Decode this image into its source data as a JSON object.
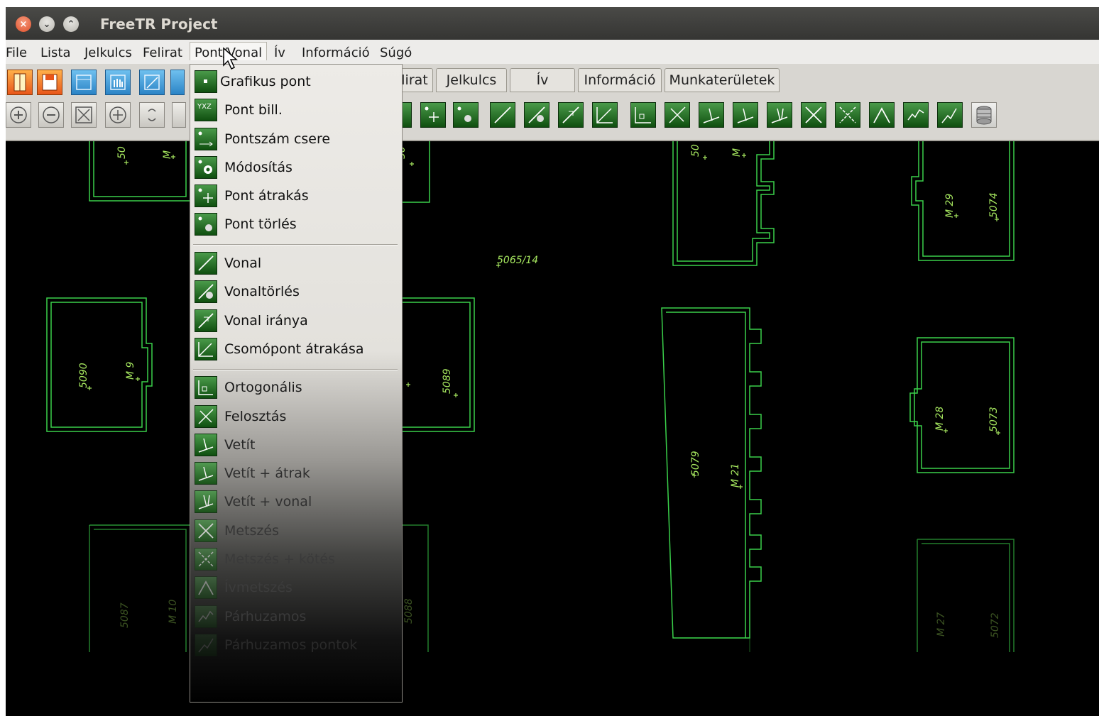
{
  "window": {
    "title": "FreeTR Project",
    "controls": {
      "close": "×",
      "minimize": "⌄",
      "maximize": "⌃"
    }
  },
  "menubar": {
    "items": [
      "File",
      "Lista",
      "Jelkulcs",
      "Felirat",
      "Pont/Vonal",
      "Ív",
      "Információ",
      "Súgó"
    ],
    "active": "Pont/Vonal"
  },
  "tabs": [
    "lirat",
    "Jelkulcs",
    "Ív",
    "Információ",
    "Munkaterületek"
  ],
  "toolbar_icons": {
    "row1": [
      "book-icon",
      "save-icon",
      "layer-icon",
      "hand-icon",
      "edit-icon",
      "layer2-icon"
    ],
    "row2_left": [
      "zoom-in-icon",
      "zoom-out-icon",
      "zoom-extent-icon",
      "pan-icon",
      "refresh-icon"
    ],
    "row2_right": [
      "point-modify-icon",
      "point-move-icon",
      "point-delete-icon",
      "line-icon",
      "line-delete-icon",
      "line-direction-icon",
      "node-move-icon",
      "orthogonal-icon",
      "divide-icon",
      "project-icon",
      "project-move-icon",
      "project-line-icon",
      "intersect-icon",
      "intersect-bind-icon",
      "arc-intersect-icon",
      "parallel-icon",
      "parallel-points-icon",
      "database-icon"
    ]
  },
  "dropdown": {
    "groups": [
      [
        {
          "label": "Grafikus pont",
          "icon": "graphic-point-icon"
        },
        {
          "label": "Pont bill.",
          "icon": "point-input-icon",
          "icon_text": "YXZ"
        },
        {
          "label": "Pontszám csere",
          "icon": "point-number-swap-icon"
        },
        {
          "label": "Módosítás",
          "icon": "point-modify-icon"
        },
        {
          "label": "Pont átrakás",
          "icon": "point-move-icon"
        },
        {
          "label": "Pont törlés",
          "icon": "point-delete-icon"
        }
      ],
      [
        {
          "label": "Vonal",
          "icon": "line-icon"
        },
        {
          "label": "Vonaltörlés",
          "icon": "line-delete-icon"
        },
        {
          "label": "Vonal iránya",
          "icon": "line-direction-icon"
        },
        {
          "label": "Csomópont átrakása",
          "icon": "node-move-icon"
        }
      ],
      [
        {
          "label": "Ortogonális",
          "icon": "orthogonal-icon"
        },
        {
          "label": "Felosztás",
          "icon": "divide-icon"
        },
        {
          "label": "Vetít",
          "icon": "project-icon"
        },
        {
          "label": "Vetít + átrak",
          "icon": "project-move-icon"
        },
        {
          "label": "Vetít + vonal",
          "icon": "project-line-icon"
        },
        {
          "label": "Metszés",
          "icon": "intersect-icon"
        },
        {
          "label": "Metszés + kötés",
          "icon": "intersect-bind-icon"
        },
        {
          "label": "Ívmetszés",
          "icon": "arc-intersect-icon"
        },
        {
          "label": "Párhuzamos",
          "icon": "parallel-icon"
        },
        {
          "label": "Párhuzamos pontok",
          "icon": "parallel-points-icon"
        }
      ]
    ]
  },
  "canvas": {
    "labels": [
      "50",
      "M",
      "50",
      "5065/14",
      "50",
      "M",
      "M 29",
      "5074",
      "5090",
      "M 9",
      "5089",
      "M 28",
      "5073",
      "5079",
      "M 21",
      "5087",
      "M 10",
      "5088",
      "M 27",
      "5072"
    ]
  },
  "colors": {
    "parcel_line": "#3ad04a",
    "label": "#a6e75f",
    "canvas_bg": "#000000"
  }
}
